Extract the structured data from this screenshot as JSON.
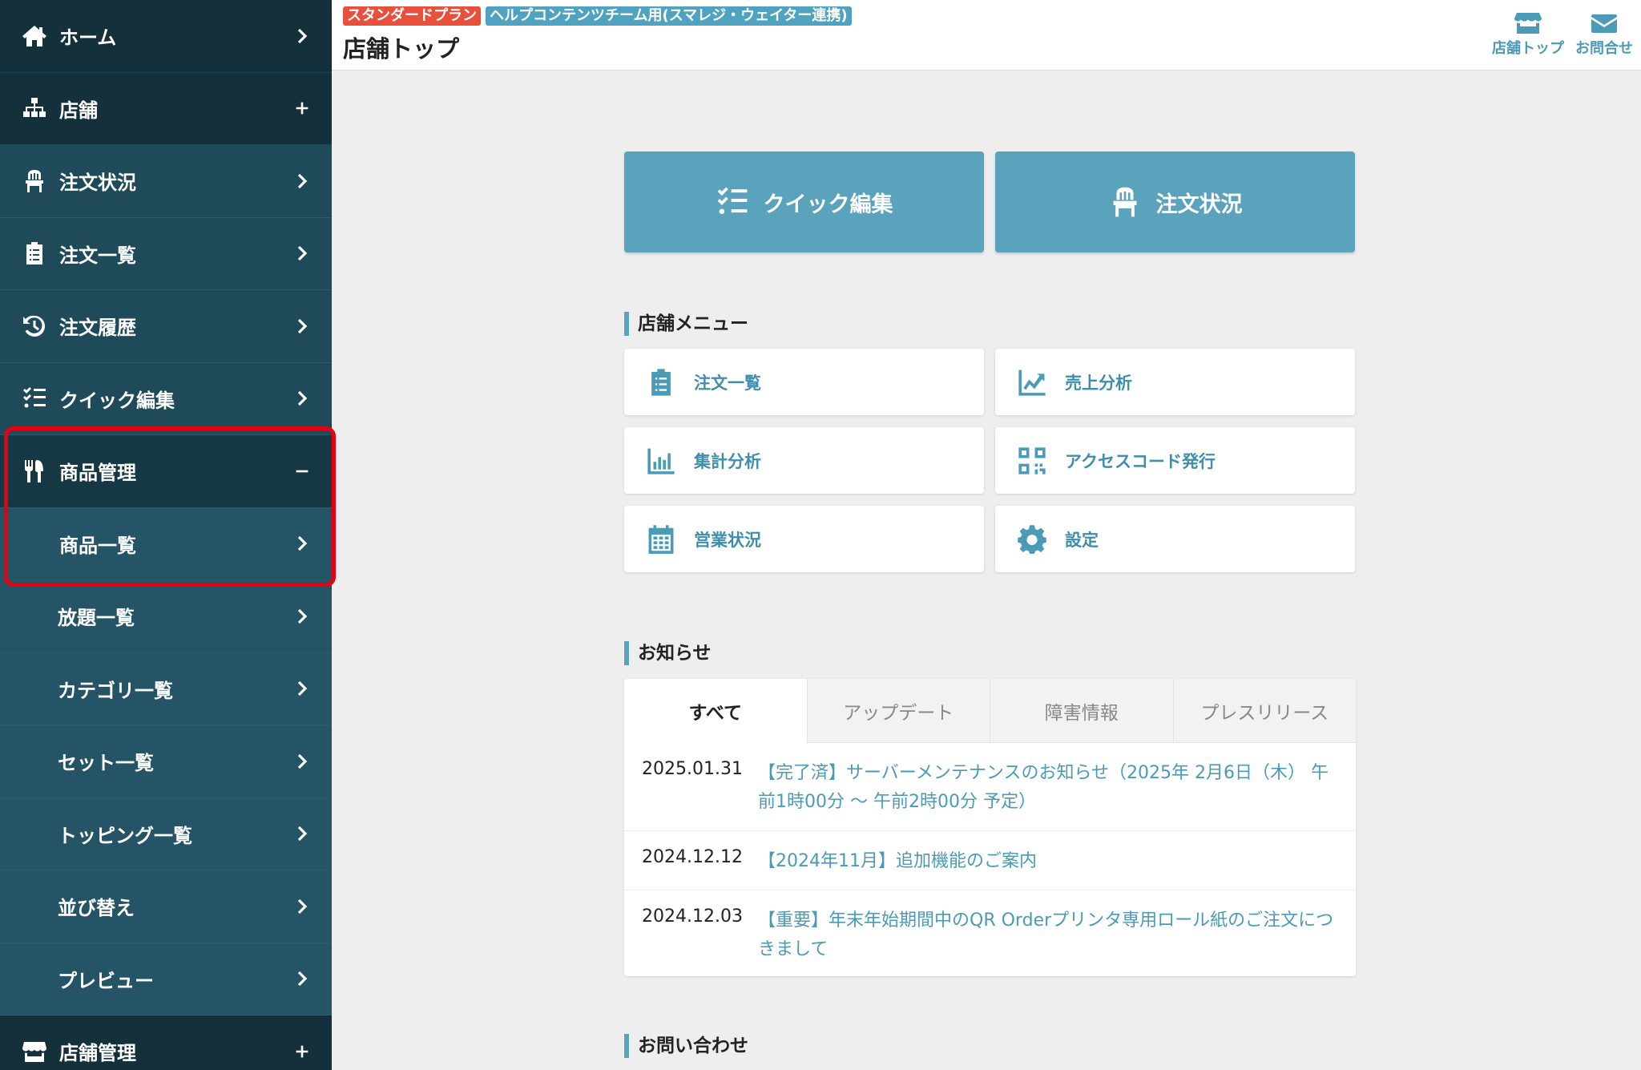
{
  "sidebar": {
    "items": [
      {
        "label": "ホーム",
        "icon": "home-icon",
        "control": "chevron"
      },
      {
        "label": "店舗",
        "icon": "sitemap-icon",
        "control": "plus"
      },
      {
        "label": "注文状況",
        "icon": "chair-icon",
        "control": "chevron"
      },
      {
        "label": "注文一覧",
        "icon": "clipboard-icon",
        "control": "chevron"
      },
      {
        "label": "注文履歴",
        "icon": "history-icon",
        "control": "chevron"
      },
      {
        "label": "クイック編集",
        "icon": "checklist-icon",
        "control": "chevron"
      },
      {
        "label": "商品管理",
        "icon": "utensils-icon",
        "control": "minus"
      },
      {
        "label": "商品一覧",
        "control": "chevron"
      },
      {
        "label": "放題一覧",
        "control": "chevron"
      },
      {
        "label": "カテゴリ一覧",
        "control": "chevron"
      },
      {
        "label": "セット一覧",
        "control": "chevron"
      },
      {
        "label": "トッピング一覧",
        "control": "chevron"
      },
      {
        "label": "並び替え",
        "control": "chevron"
      },
      {
        "label": "プレビュー",
        "control": "chevron"
      },
      {
        "label": "店舗管理",
        "icon": "store-icon",
        "control": "plus"
      }
    ],
    "highlight_color": "#e60012"
  },
  "header": {
    "badge_plan": "スタンダードプラン",
    "badge_store": "ヘルプコンテンツチーム用(スマレジ・ウェイター連携)",
    "title": "店舗トップ",
    "link_store_top": "店舗トップ",
    "link_contact": "お問合せ"
  },
  "main": {
    "quick_edit_label": "クイック編集",
    "order_status_label": "注文状況",
    "store_menu_title": "店舗メニュー",
    "menu": [
      {
        "label": "注文一覧",
        "icon": "clipboard-icon"
      },
      {
        "label": "売上分析",
        "icon": "chart-line-icon"
      },
      {
        "label": "集計分析",
        "icon": "chart-bar-icon"
      },
      {
        "label": "アクセスコード発行",
        "icon": "qrcode-icon"
      },
      {
        "label": "営業状況",
        "icon": "calendar-icon"
      },
      {
        "label": "設定",
        "icon": "gear-icon"
      }
    ],
    "news_title": "お知らせ",
    "tabs": [
      "すべて",
      "アップデート",
      "障害情報",
      "プレスリリース"
    ],
    "news": [
      {
        "date": "2025.01.31",
        "text": "【完了済】サーバーメンテナンスのお知らせ（2025年 2月6日（木） 午前1時00分 〜 午前2時00分 予定）"
      },
      {
        "date": "2024.12.12",
        "text": "【2024年11月】追加機能のご案内"
      },
      {
        "date": "2024.12.03",
        "text": "【重要】年末年始期間中のQR Orderプリンタ専用ロール紙のご注文につきまして"
      }
    ],
    "contact_title": "お問い合わせ"
  },
  "colors": {
    "sidebar_bg": "#1e4a5a",
    "accent": "#5ba3bd",
    "badge_red": "#e8503b",
    "badge_blue": "#4fa3c0"
  }
}
